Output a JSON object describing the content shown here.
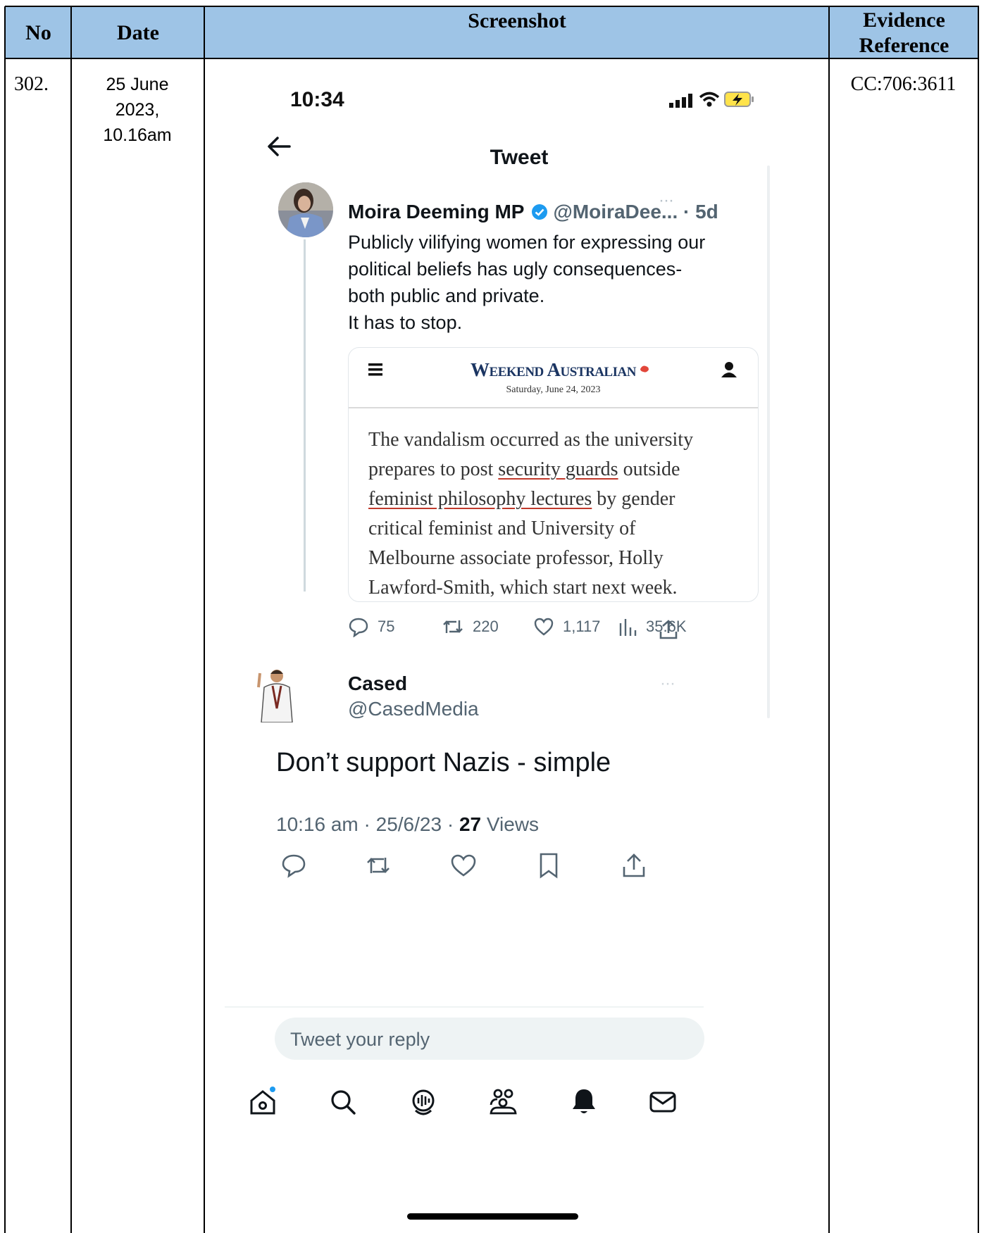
{
  "table": {
    "headers": {
      "no": "No",
      "date": "Date",
      "screenshot": "Screenshot",
      "evidence_reference": "Evidence Reference"
    },
    "row": {
      "no": "302.",
      "date_line1": "25 June",
      "date_line2": "2023,",
      "date_line3": "10.16am",
      "evidence_reference": "CC:706:3611"
    }
  },
  "phone": {
    "status_time": "10:34",
    "page_title": "Tweet",
    "original_tweet": {
      "author_name": "Moira Deeming MP",
      "handle_time": "@MoiraDee... · 5d",
      "text_lines": [
        "Publicly vilifying women for expressing our",
        "political beliefs has ugly consequences-",
        "both public and private.",
        "It has to stop."
      ],
      "card": {
        "masthead": "Weekend Australian",
        "date": "Saturday, June 24, 2023",
        "article_lines": [
          "The vandalism occurred as the university",
          "prepares to post ",
          "security guards",
          " outside",
          "feminist philosophy lectures",
          " by gender",
          "critical feminist and University of",
          "Melbourne associate professor, Holly",
          "Lawford-Smith, which start next week."
        ]
      },
      "metrics": {
        "replies": "75",
        "retweets": "220",
        "likes": "1,117",
        "views": "35.6K"
      }
    },
    "reply_tweet": {
      "author_name": "Cased",
      "handle": "@CasedMedia",
      "text": "Don’t support Nazis - simple",
      "time_date": "10:16 am · 25/6/23 · ",
      "views_count": "27",
      "views_label": " Views"
    },
    "reply_placeholder": "Tweet your reply",
    "colors": {
      "verified_blue": "#1d9bf0",
      "text_dark": "#0f1419",
      "text_gray": "#536471",
      "header_blue": "#9ec4e6"
    }
  }
}
